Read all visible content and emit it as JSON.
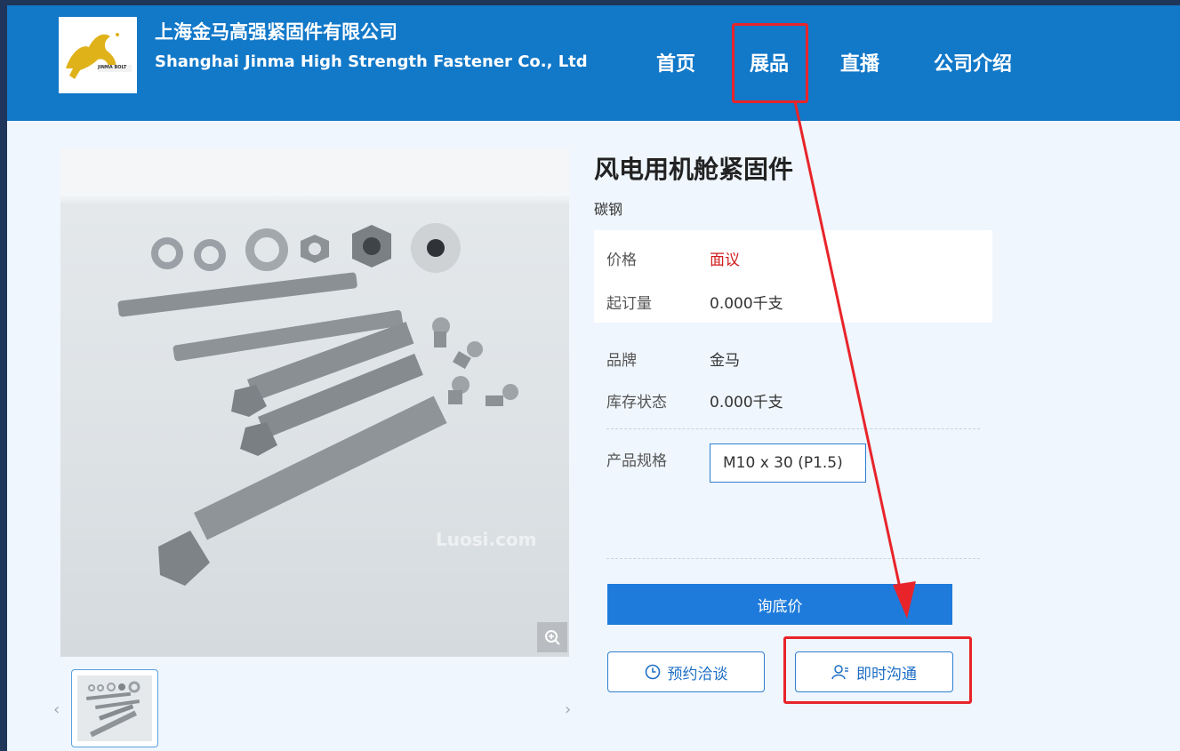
{
  "header": {
    "company_cn": "上海金马高强紧固件有限公司",
    "company_en": "Shanghai Jinma High Strength Fastener Co., Ltd",
    "logo_text": "JINMA BOLT",
    "nav": [
      {
        "label": "首页"
      },
      {
        "label": "展品"
      },
      {
        "label": "直播"
      },
      {
        "label": "公司介绍"
      }
    ],
    "active_nav": "展品"
  },
  "product": {
    "title": "风电用机舱紧固件",
    "material": "碳钢",
    "watermark": "Luosi.com",
    "price_label": "价格",
    "price_value": "面议",
    "moq_label": "起订量",
    "moq_value": "0.000千支",
    "brand_label": "品牌",
    "brand_value": "金马",
    "stock_label": "库存状态",
    "stock_value": "0.000千支",
    "spec_label": "产品规格",
    "spec_value": "M10 x 30 (P1.5)"
  },
  "actions": {
    "inquiry_label": "询底价",
    "appointment_label": "预约洽谈",
    "chat_label": "即时沟通"
  },
  "gallery": {
    "prev": "‹",
    "next": "›"
  },
  "colors": {
    "header_bg": "#1278c8",
    "accent": "#1f7bdb",
    "price_red": "#d01c1c",
    "annotation_red": "#e8242a"
  }
}
